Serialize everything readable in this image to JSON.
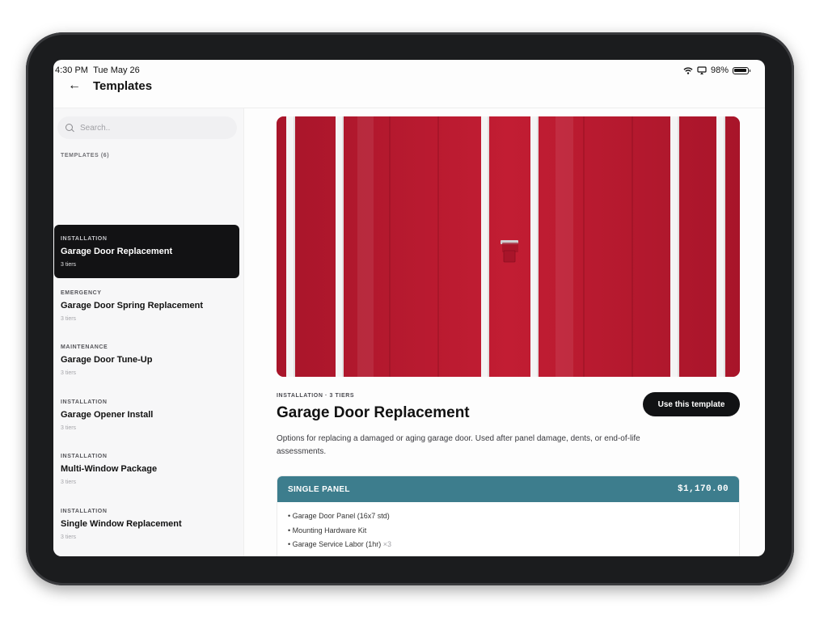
{
  "status_bar": {
    "time": "4:30 PM",
    "date": "Tue May 26",
    "battery": "98%",
    "battery_level": 0.98,
    "icons": [
      "wifi-icon",
      "airplay-icon",
      "battery-icon"
    ]
  },
  "header": {
    "back_icon": "←",
    "title": "Templates"
  },
  "sidebar": {
    "search_placeholder": "Search..",
    "section_label": "TEMPLATES (6)",
    "items": [
      {
        "category": "INSTALLATION",
        "title": "Garage Door Replacement",
        "tiers": "3 tiers",
        "active": true
      },
      {
        "category": "EMERGENCY",
        "title": "Garage Door Spring Replacement",
        "tiers": "3 tiers",
        "active": false
      },
      {
        "category": "MAINTENANCE",
        "title": "Garage Door Tune-Up",
        "tiers": "3 tiers",
        "active": false
      },
      {
        "category": "INSTALLATION",
        "title": "Garage Opener Install",
        "tiers": "3 tiers",
        "active": false
      },
      {
        "category": "INSTALLATION",
        "title": "Multi-Window Package",
        "tiers": "3 tiers",
        "active": false
      },
      {
        "category": "INSTALLATION",
        "title": "Single Window Replacement",
        "tiers": "3 tiers",
        "active": false
      }
    ]
  },
  "detail": {
    "eyebrow": "INSTALLATION · 3 TIERS",
    "title": "Garage Door Replacement",
    "use_button": "Use this template",
    "description": "Options for replacing a damaged or aging garage door. Used after panel damage, dents, or end-of-life assessments.",
    "tier": {
      "name": "SINGLE PANEL",
      "price": "$1,170.00",
      "items": [
        {
          "label": "Garage Door Panel (16x7 std)",
          "qty": ""
        },
        {
          "label": "Mounting Hardware Kit",
          "qty": ""
        },
        {
          "label": "Garage Service Labor (1hr)",
          "qty": "×3"
        }
      ]
    }
  },
  "colors": {
    "accent": "#3d7d8d",
    "active_item": "#121214",
    "door_red": "#b91a2e",
    "button": "#111214"
  }
}
